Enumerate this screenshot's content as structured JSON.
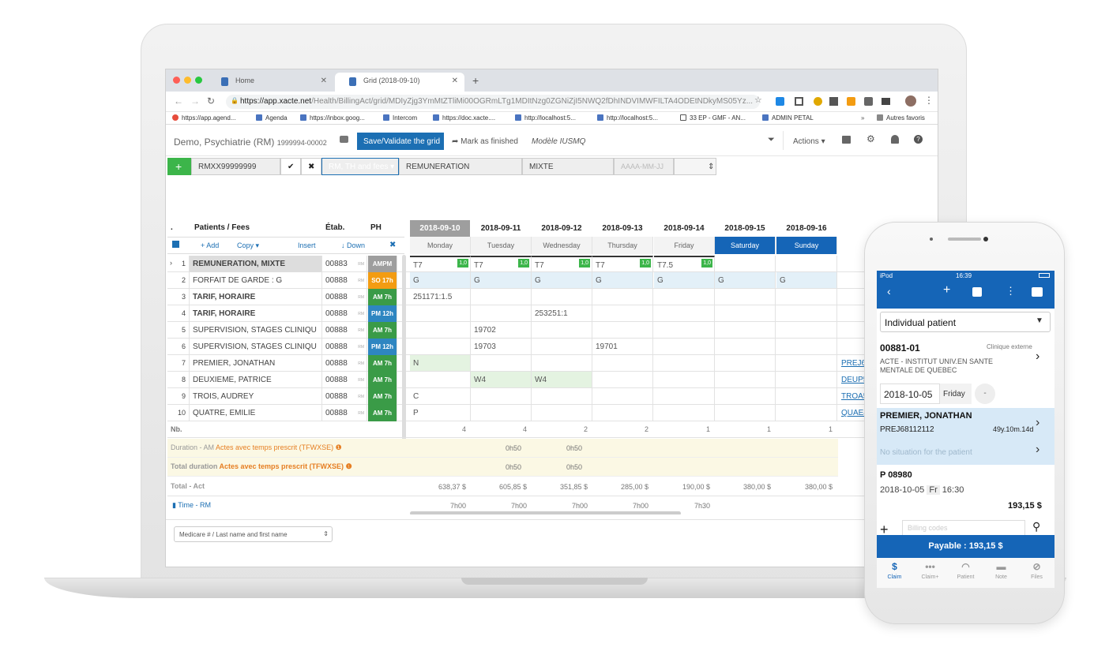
{
  "browser": {
    "tabs": [
      {
        "label": "Home"
      },
      {
        "label": "Grid (2018-09-10)"
      }
    ],
    "url_host": "https://app.xacte.net",
    "url_path": "/Health/BillingAct/grid/MDIyZjg3YmMtZTliMi00OGRmLTg1MDItNzg0ZGNiZjI5NWQ2fDhINDVIMWFILTA4ODEtNDkyMS05Yz...",
    "bookmarks": [
      "https://app.agend...",
      "Agenda",
      "https://inbox.goog...",
      "Intercom",
      "https://doc.xacte....",
      "http://localhost:5...",
      "http://localhost:5...",
      "33 EP - GMF - AN...",
      "ADMIN PETAL"
    ],
    "other_bookmarks": "Autres favoris"
  },
  "header": {
    "title": "Demo, Psychiatrie (RM)",
    "subtitle": "1999994-00002",
    "save_label": "Save/Validate the grid",
    "finish_label": "Mark as finished",
    "model_label": "Modèle IUSMQ",
    "actions_label": "Actions"
  },
  "toolbar": {
    "add": "+",
    "code": "RMXX99999999",
    "ok": "✔",
    "cancel": "✖",
    "mode": "RM, TH and fees",
    "type": "REMUNERATION",
    "mix": "MIXTE",
    "date_placeholder": "AAAA-MM-JJ"
  },
  "grid": {
    "head_dot": ".",
    "head_patients": "Patients / Fees",
    "head_etab": "Étab.",
    "head_ph": "PH",
    "add_label": "Add",
    "copy_label": "Copy",
    "insert_label": "Insert",
    "down_label": "Down",
    "dates": [
      "2018-09-10",
      "2018-09-11",
      "2018-09-12",
      "2018-09-13",
      "2018-09-14",
      "2018-09-15",
      "2018-09-16"
    ],
    "days": [
      "Monday",
      "Tuesday",
      "Wednesday",
      "Thursday",
      "Friday",
      "Saturday",
      "Sunday"
    ],
    "rows": [
      {
        "n": "1",
        "name": "REMUNERATION, MIXTE",
        "etab": "00883",
        "rm": "RM",
        "ph": "AMPM",
        "phcolor": "#9e9e9e"
      },
      {
        "n": "2",
        "name": "FORFAIT DE GARDE : G",
        "etab": "00888",
        "rm": "RM",
        "ph": "SO 17h",
        "phcolor": "#f39c12"
      },
      {
        "n": "3",
        "name": "TARIF, HORAIRE",
        "etab": "00888",
        "rm": "RM",
        "ph": "AM 7h",
        "phcolor": "#3a9b47"
      },
      {
        "n": "4",
        "name": "TARIF, HORAIRE",
        "etab": "00888",
        "rm": "RM",
        "ph": "PM 12h",
        "phcolor": "#2e86c1"
      },
      {
        "n": "5",
        "name": "SUPERVISION, STAGES CLINIQU",
        "etab": "00888",
        "rm": "RM",
        "ph": "AM 7h",
        "phcolor": "#3a9b47"
      },
      {
        "n": "6",
        "name": "SUPERVISION, STAGES CLINIQU",
        "etab": "00888",
        "rm": "RM",
        "ph": "PM 12h",
        "phcolor": "#2e86c1"
      },
      {
        "n": "7",
        "name": "PREMIER, JONATHAN",
        "etab": "00888",
        "rm": "RM",
        "ph": "AM 7h",
        "phcolor": "#3a9b47"
      },
      {
        "n": "8",
        "name": "DEUXIEME, PATRICE",
        "etab": "00888",
        "rm": "RM",
        "ph": "AM 7h",
        "phcolor": "#3a9b47"
      },
      {
        "n": "9",
        "name": "TROIS, AUDREY",
        "etab": "00888",
        "rm": "RM",
        "ph": "AM 7h",
        "phcolor": "#3a9b47"
      },
      {
        "n": "10",
        "name": "QUATRE, EMILIE",
        "etab": "00888",
        "rm": "RM",
        "ph": "AM 7h",
        "phcolor": "#3a9b47"
      }
    ],
    "r1": [
      "T7",
      "T7",
      "T7",
      "T7",
      "T7.5"
    ],
    "r1_badge": "1,0",
    "g": "G",
    "r3_mon": "251171:1.5",
    "r4_wed": "253251:1",
    "r5_tue": "19702",
    "r6_tue": "19703",
    "r6_thu": "19701",
    "r7_mon": "N",
    "r8_tue": "W4",
    "r8_wed": "W4",
    "r9_mon": "C",
    "r10_mon": "P",
    "links": [
      "PREJ68",
      "DEUP5",
      "TROA5",
      "QUAE4"
    ],
    "nb_label": "Nb.",
    "nb": [
      "4",
      "4",
      "2",
      "2",
      "1",
      "1",
      "1"
    ],
    "dur_label1": "Duration - AM",
    "dur_label2": "Actes avec temps prescrit (TFWXSE)",
    "dur_tue": "0h50",
    "dur_wed": "0h50",
    "tdur_label1": "Total duration",
    "tdur_label2": "Actes avec temps prescrit (TFWXSE)",
    "tdur_tue": "0h50",
    "tdur_wed": "0h50",
    "total_label": "Total - Act",
    "totals": [
      "638,37 $",
      "605,85 $",
      "351,85 $",
      "285,00 $",
      "190,00 $",
      "380,00 $",
      "380,00 $"
    ],
    "time_label": "Time - RM",
    "times": [
      "7h00",
      "7h00",
      "7h00",
      "7h00",
      "7h30"
    ]
  },
  "footer": {
    "search_placeholder": "Medicare # / Last name and first name"
  },
  "phone": {
    "status_left": "iPod",
    "status_time": "16:39",
    "select": "Individual patient",
    "code": "00881-01",
    "clinic": "Clinique externe",
    "inst1": "ACTE - INSTITUT UNIV.EN SANTE",
    "inst2": "MENTALE DE QUEBEC",
    "date": "2018-10-05",
    "day": "Friday",
    "dash": "-",
    "patient": "PREMIER, JONATHAN",
    "patient_id": "PREJ68112112",
    "age": "49y.10m.14d",
    "no_situation": "No situation for the patient",
    "p_code": "P 08980",
    "p_date": "2018-10-05",
    "p_day": "Fr",
    "p_time": "16:30",
    "p_amount": "193,15 $",
    "billing_placeholder": "Billing codes",
    "payable": "Payable : 193,15 $",
    "tabs": [
      "Claim",
      "Claim+",
      "Patient",
      "Note",
      "Files"
    ]
  }
}
